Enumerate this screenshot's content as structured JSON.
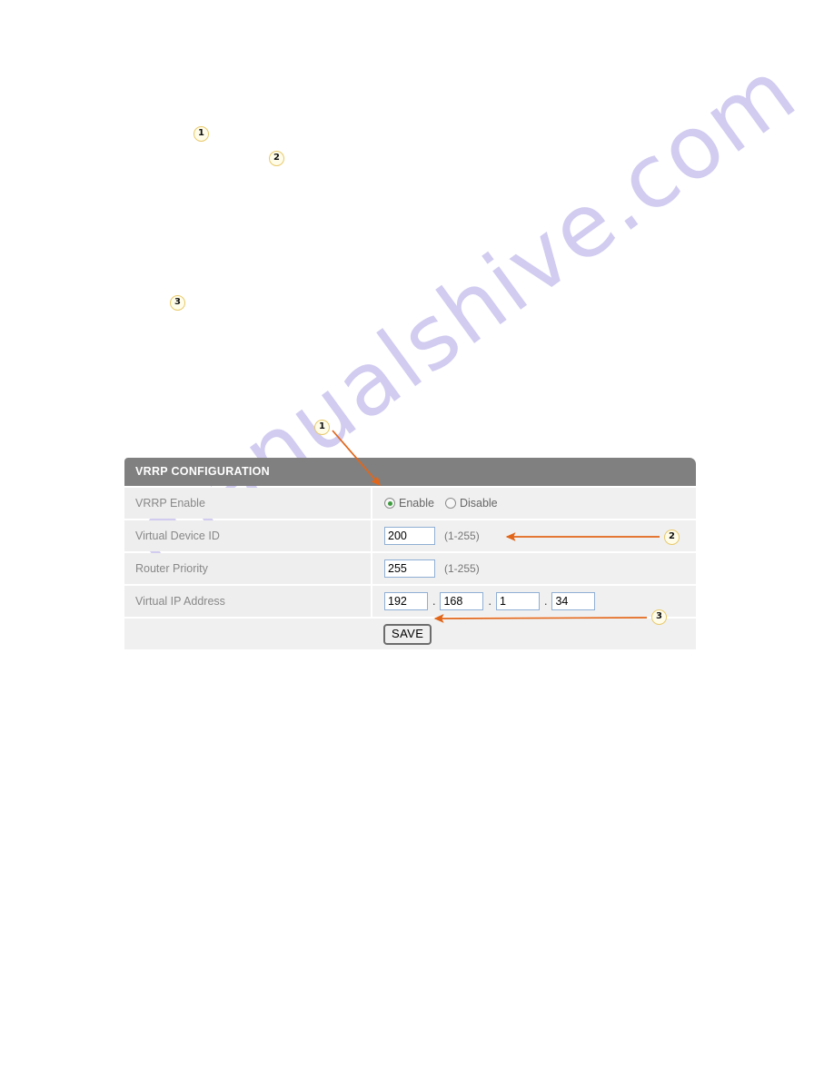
{
  "watermark": {
    "text": "manualshive.com"
  },
  "callouts": [
    {
      "id": "callout-top-1",
      "number": "1"
    },
    {
      "id": "callout-top-2",
      "number": "2"
    },
    {
      "id": "callout-top-3",
      "number": "3"
    },
    {
      "id": "callout-panel-1",
      "number": "1"
    },
    {
      "id": "callout-panel-2",
      "number": "2"
    },
    {
      "id": "callout-panel-3",
      "number": "3"
    }
  ],
  "panel": {
    "title": "VRRP CONFIGURATION",
    "rows": [
      {
        "label": "VRRP Enable",
        "type": "radio",
        "options": [
          {
            "label": "Enable",
            "checked": true
          },
          {
            "label": "Disable",
            "checked": false
          }
        ]
      },
      {
        "label": "Virtual Device ID",
        "type": "text",
        "value": "200",
        "hint": "(1-255)"
      },
      {
        "label": "Router Priority",
        "type": "text",
        "value": "255",
        "hint": "(1-255)"
      },
      {
        "label": "Virtual IP Address",
        "type": "ip",
        "octets": [
          "192",
          "168",
          "1",
          "34"
        ],
        "separator": "."
      }
    ],
    "save_label": "SAVE"
  },
  "colors": {
    "header_bar": "#808080",
    "row_label_bg": "#eeeeee",
    "row_value_bg": "#f0f0f0",
    "input_border": "#8fafd4",
    "radio_checked": "#3d9b3d",
    "arrow": "#e2661a",
    "callout_fill": "#fffdea",
    "callout_border": "#e8c96a",
    "watermark": "#c9c4ee"
  }
}
